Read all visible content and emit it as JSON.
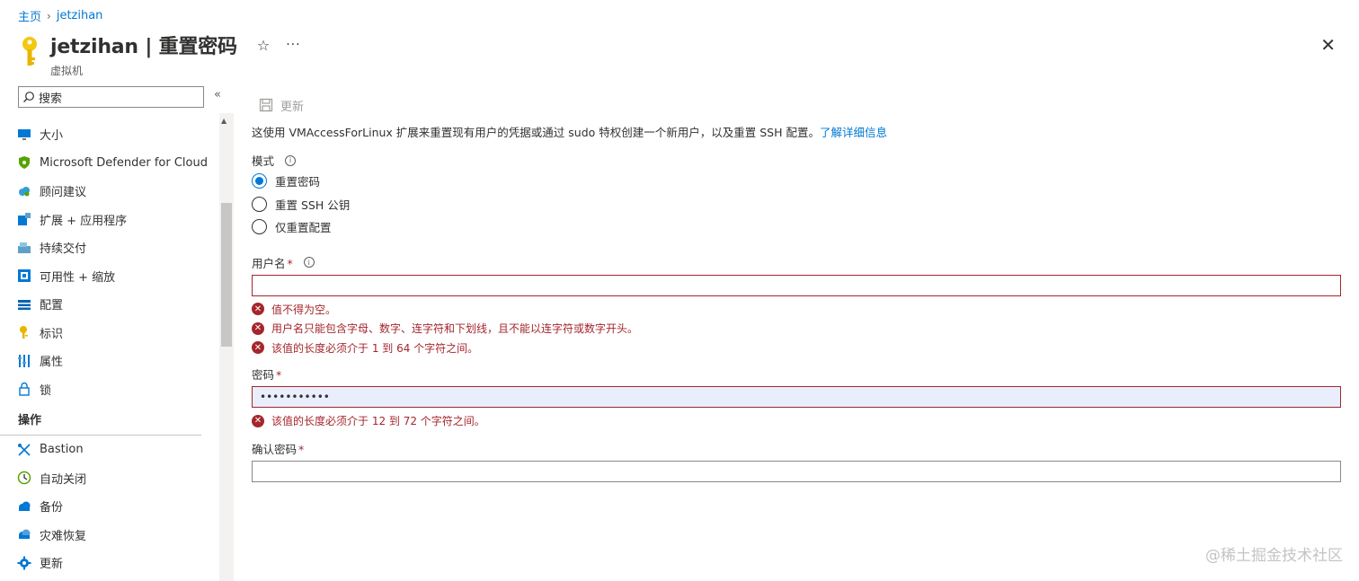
{
  "breadcrumb": {
    "home": "主页",
    "current": "jetzihan"
  },
  "header": {
    "title": "jetzihan | 重置密码",
    "subtitle": "虚拟机",
    "star": "☆",
    "more": "···",
    "close": "✕"
  },
  "sidebar": {
    "search_placeholder": "搜索",
    "collapse": "«",
    "items": [
      {
        "label": "大小",
        "icon": "monitor-icon",
        "color": "#0078d4"
      },
      {
        "label": "Microsoft Defender for Cloud",
        "icon": "shield-icon",
        "color": "#57a300"
      },
      {
        "label": "顾问建议",
        "icon": "cloud-advisor-icon",
        "color": "#2ea0d6"
      },
      {
        "label": "扩展 + 应用程序",
        "icon": "extensions-icon",
        "color": "#0078d4"
      },
      {
        "label": "持续交付",
        "icon": "delivery-icon",
        "color": "#5ea0c8"
      },
      {
        "label": "可用性 + 缩放",
        "icon": "availability-icon",
        "color": "#0078d4"
      },
      {
        "label": "配置",
        "icon": "config-icon",
        "color": "#0063b1"
      },
      {
        "label": "标识",
        "icon": "identity-icon",
        "color": "#e8b500"
      },
      {
        "label": "属性",
        "icon": "properties-icon",
        "color": "#0078d4"
      },
      {
        "label": "锁",
        "icon": "lock-icon",
        "color": "#0078d4"
      }
    ],
    "section": "操作",
    "ops_items": [
      {
        "label": "Bastion",
        "icon": "bastion-icon",
        "color": "#0078d4"
      },
      {
        "label": "自动关闭",
        "icon": "clock-icon",
        "color": "#57a300"
      },
      {
        "label": "备份",
        "icon": "backup-icon",
        "color": "#0078d4"
      },
      {
        "label": "灾难恢复",
        "icon": "recovery-icon",
        "color": "#0078d4"
      },
      {
        "label": "更新",
        "icon": "gear-icon",
        "color": "#0078d4"
      }
    ]
  },
  "toolbar": {
    "update": "更新"
  },
  "description": {
    "text": "这使用 VMAccessForLinux 扩展来重置现有用户的凭据或通过 sudo 特权创建一个新用户，以及重置 SSH 配置。",
    "link": "了解详细信息"
  },
  "mode": {
    "label": "模式",
    "options": [
      "重置密码",
      "重置 SSH 公钥",
      "仅重置配置"
    ],
    "selected": 0
  },
  "username": {
    "label": "用户名",
    "required": "*",
    "value": "",
    "errors": [
      "值不得为空。",
      "用户名只能包含字母、数字、连字符和下划线，且不能以连字符或数字开头。",
      "该值的长度必须介于 1 到 64 个字符之间。"
    ]
  },
  "password": {
    "label": "密码",
    "required": "*",
    "value": "•••••••••••",
    "errors": [
      "该值的长度必须介于 12 到 72 个字符之间。"
    ]
  },
  "confirm": {
    "label": "确认密码",
    "required": "*",
    "value": ""
  },
  "watermark": "@稀土掘金技术社区",
  "colors": {
    "accent": "#0078d4",
    "error": "#a4262c"
  }
}
